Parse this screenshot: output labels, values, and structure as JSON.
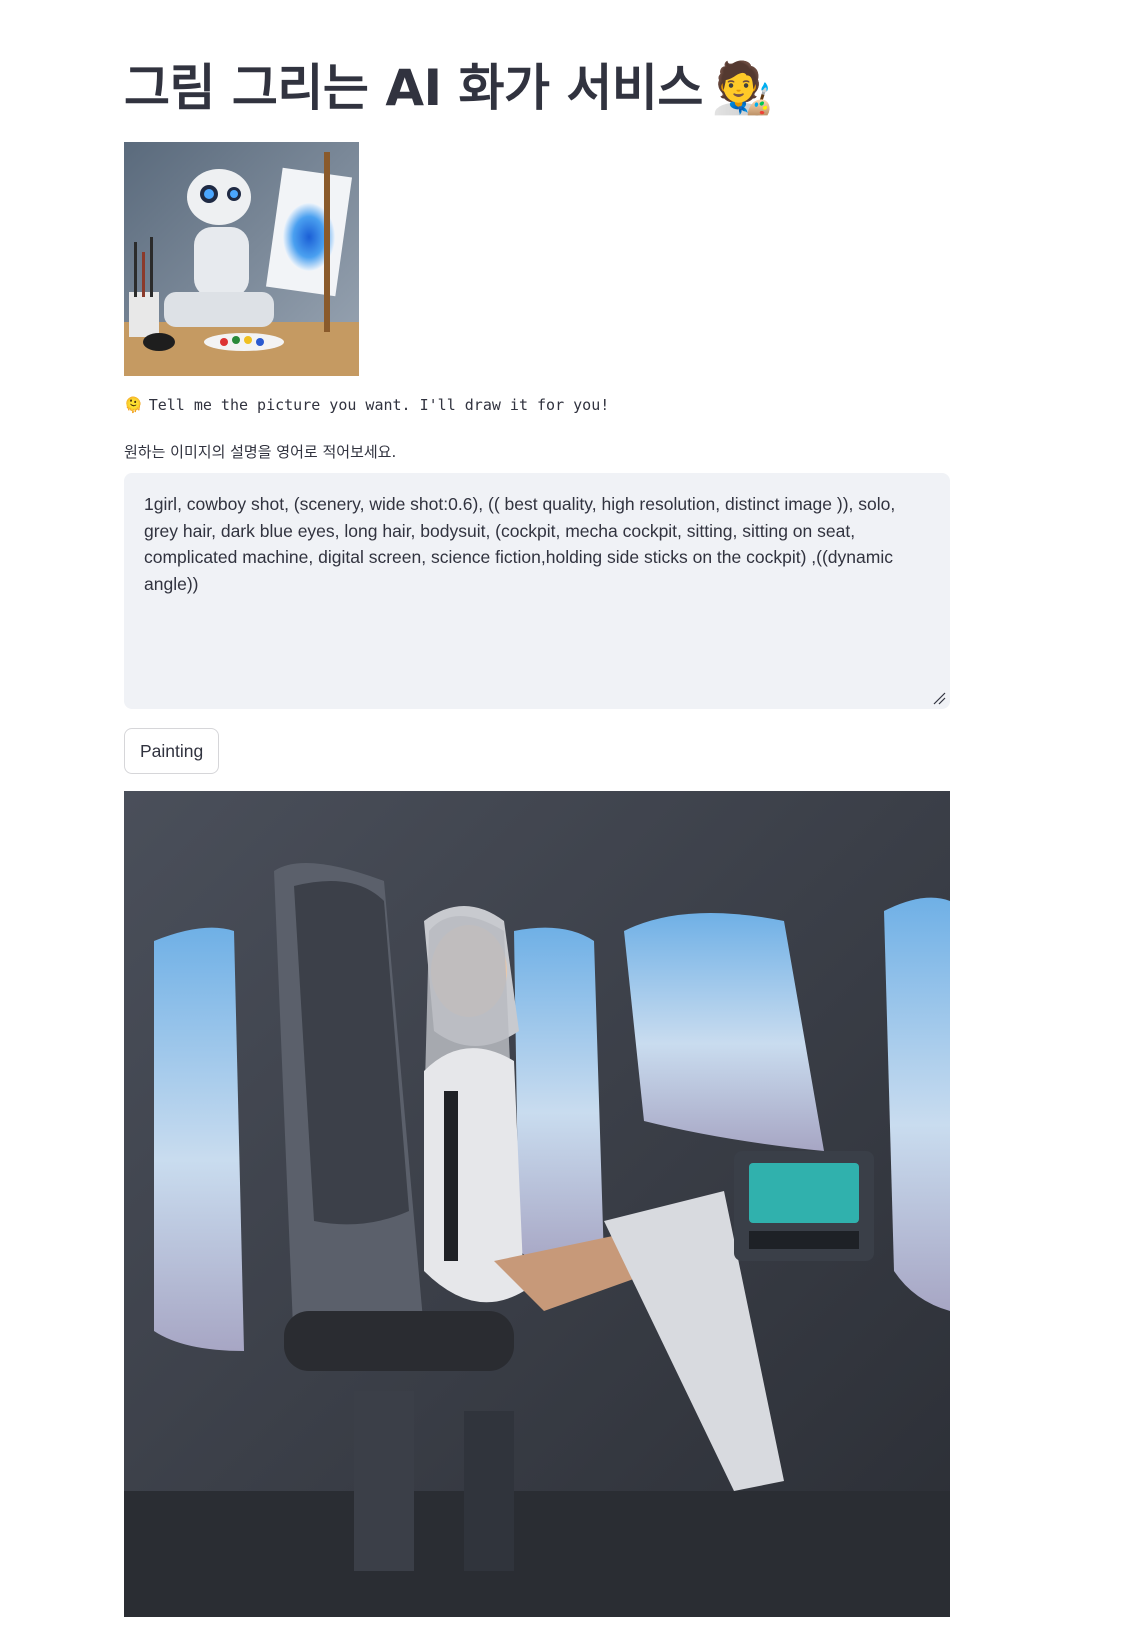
{
  "header": {
    "title": "그림 그리는 AI 화가 서비스",
    "title_emoji": "🧑‍🎨"
  },
  "hero_image": {
    "alt_icon": "robot-painting-image"
  },
  "caption": {
    "emoji": "🫠",
    "text": "Tell me the picture you want. I'll draw it for you!"
  },
  "prompt": {
    "label": "원하는 이미지의 설명을 영어로 적어보세요.",
    "value": "1girl, cowboy shot, (scenery, wide shot:0.6), (( best quality, high resolution, distinct image )), solo, grey hair, dark blue eyes, long hair, bodysuit, (cockpit, mecha cockpit, sitting, sitting on seat, complicated machine, digital screen, science fiction,holding side sticks on the cockpit) ,((dynamic angle))"
  },
  "actions": {
    "paint_label": "Painting"
  },
  "result_image": {
    "alt_icon": "generated-cockpit-image"
  },
  "colors": {
    "text": "#31333f",
    "input_bg": "#f0f2f6",
    "border": "#d6d6d9"
  }
}
